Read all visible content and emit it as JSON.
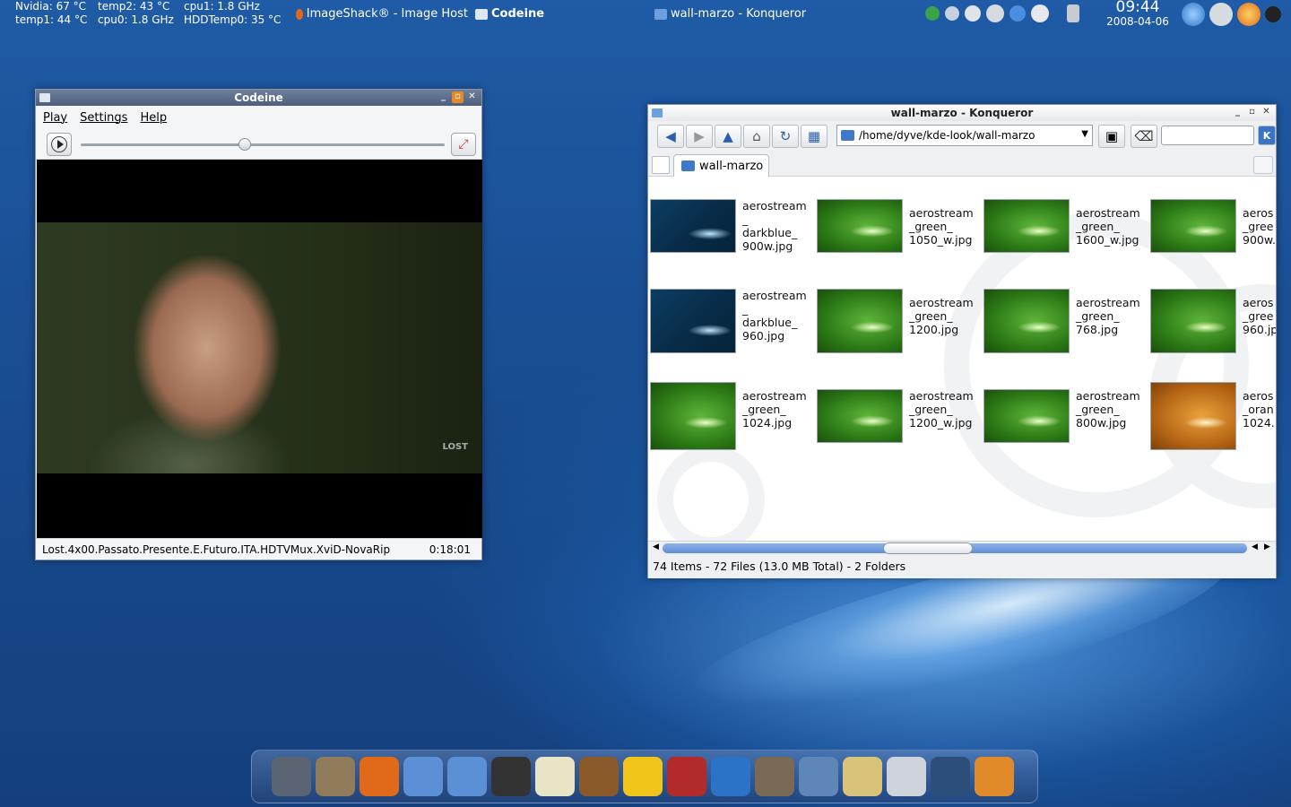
{
  "sysmon": {
    "nvidia": "Nvidia: 67 °C",
    "temp1": "temp1: 44 °C",
    "temp2": "temp2: 43 °C",
    "cpu0": "cpu0: 1.8 GHz",
    "cpu1": "cpu1: 1.8 GHz",
    "hdd": "HDDTemp0: 35 °C"
  },
  "taskbar": {
    "tasks": [
      {
        "label": "ImageShack® - Image Host",
        "icon": "firefox-icon"
      },
      {
        "label": "Codeine",
        "icon": "clapper-icon"
      },
      {
        "label": "wall-marzo - Konqueror",
        "icon": "folder-icon"
      }
    ]
  },
  "clock": {
    "time": "09:44",
    "date": "2008-04-06"
  },
  "codeine": {
    "title": "Codeine",
    "menu": [
      "Play",
      "Settings",
      "Help"
    ],
    "seek_fraction": 0.45,
    "video_logo": "LOST",
    "filename": "Lost.4x00.Passato.Presente.E.Futuro.ITA.HDTVMux.XviD-NovaRip",
    "time": "0:18:01"
  },
  "konqueror": {
    "title": "wall-marzo - Konqueror",
    "address": "/home/dyve/kde-look/wall-marzo",
    "tab": "wall-marzo",
    "status": "74 Items - 72 Files (13.0 MB Total) - 2 Folders",
    "items": [
      {
        "name": "aerostream\n_\ndarkblue_\n900w.jpg",
        "color": "blue"
      },
      {
        "name": "aerostream\n_green_\n1050_w.jpg",
        "color": "green"
      },
      {
        "name": "aerostream\n_green_\n1600_w.jpg",
        "color": "green"
      },
      {
        "name": "aeros\n_gree\n900w.",
        "color": "green"
      },
      {
        "name": "aerostream\n_\ndarkblue_\n960.jpg",
        "color": "blue"
      },
      {
        "name": "aerostream\n_green_\n1200.jpg",
        "color": "green"
      },
      {
        "name": "aerostream\n_green_\n768.jpg",
        "color": "green"
      },
      {
        "name": "aeros\n_gree\n960.jp",
        "color": "green"
      },
      {
        "name": "aerostream\n_green_\n1024.jpg",
        "color": "green"
      },
      {
        "name": "aerostream\n_green_\n1200_w.jpg",
        "color": "green"
      },
      {
        "name": "aerostream\n_green_\n800w.jpg",
        "color": "green"
      },
      {
        "name": "aeros\n_oran\n1024.",
        "color": "orange"
      }
    ]
  },
  "dock": [
    "kde-menu-icon",
    "home-icon",
    "firefox-icon",
    "downloads-folder-icon",
    "network-folder-icon",
    "alert-icon",
    "lightbulb-icon",
    "cow-icon",
    "office-icon",
    "dictionary-icon",
    "search-icon",
    "gimp-icon",
    "photo-icon",
    "compass-icon",
    "disk-icon",
    "editor-icon",
    "movie-icon"
  ]
}
